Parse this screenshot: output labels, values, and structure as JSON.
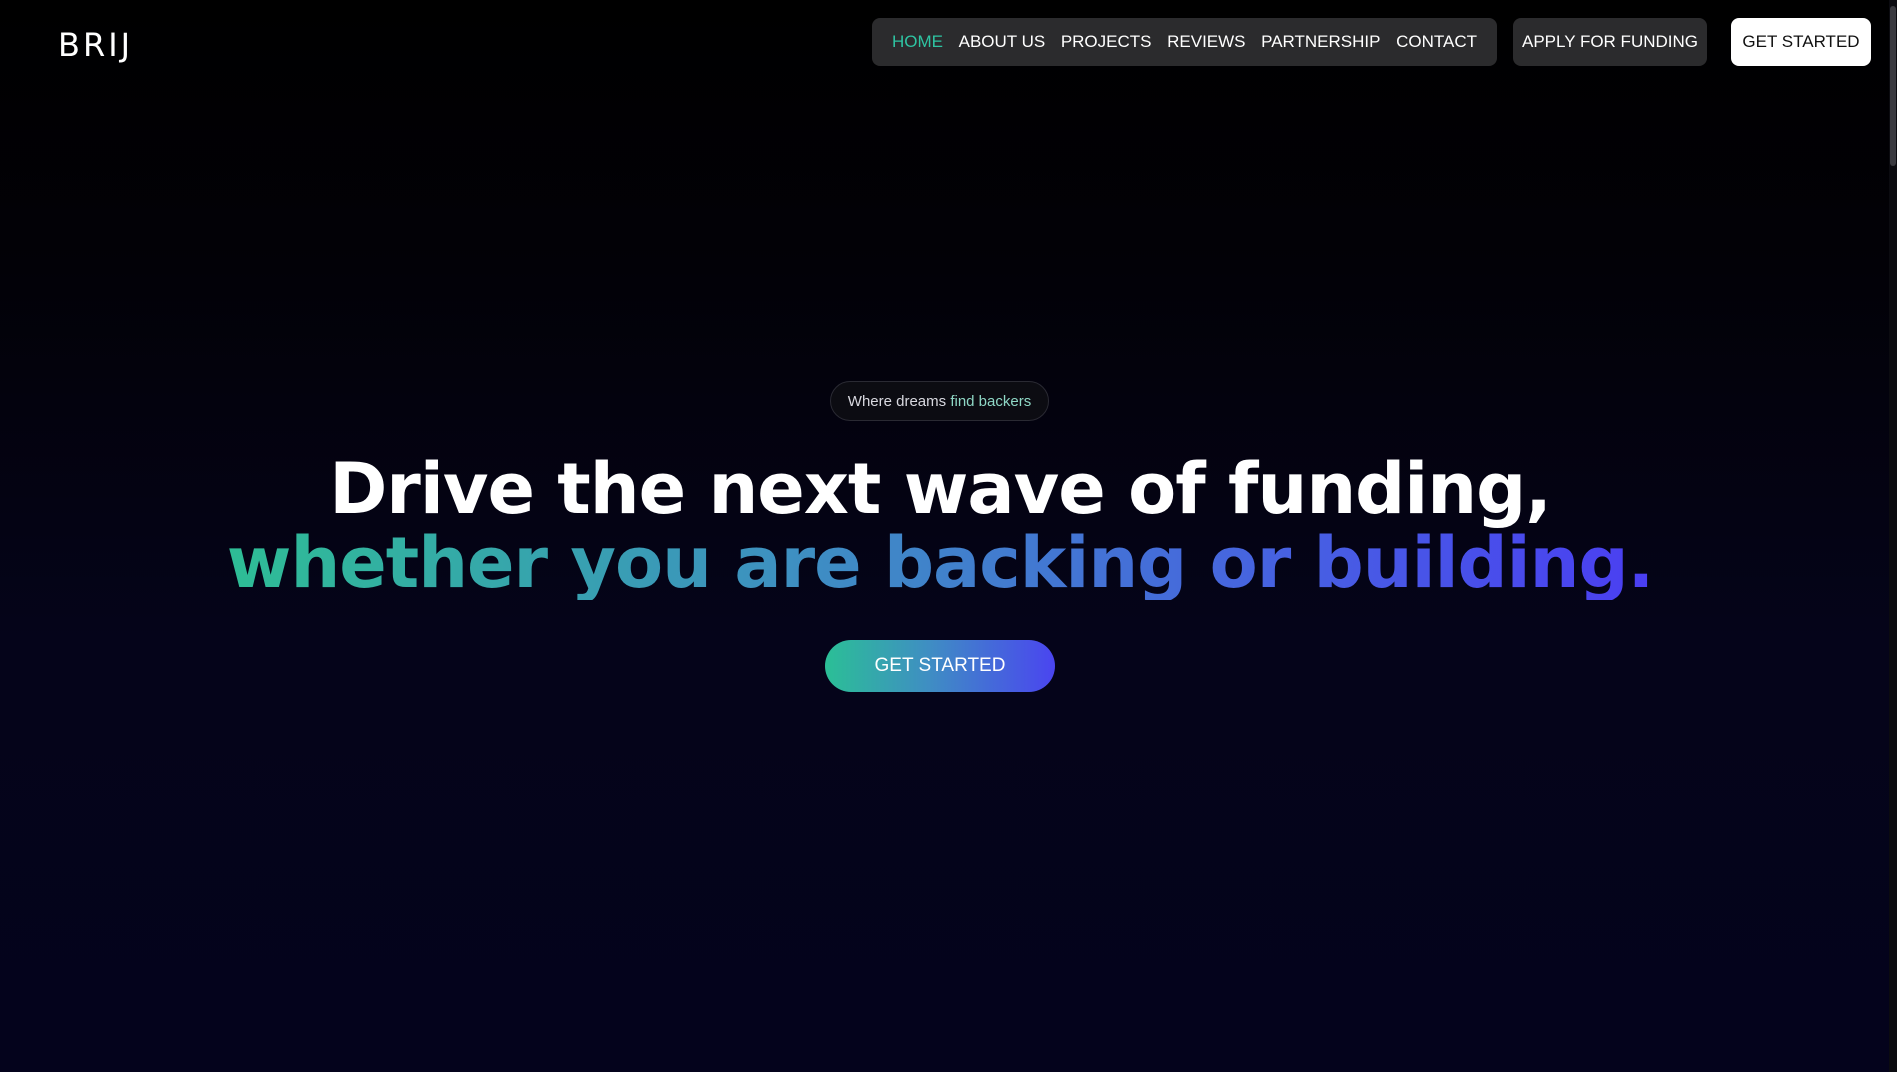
{
  "header": {
    "logo": "BRIJ",
    "nav": [
      {
        "label": "HOME",
        "active": true
      },
      {
        "label": "ABOUT US",
        "active": false
      },
      {
        "label": "PROJECTS",
        "active": false
      },
      {
        "label": "REVIEWS",
        "active": false
      },
      {
        "label": "PARTNERSHIP",
        "active": false
      },
      {
        "label": "CONTACT",
        "active": false
      }
    ],
    "apply_label": "APPLY FOR FUNDING",
    "get_started_label": "GET STARTED"
  },
  "hero": {
    "tagline_prefix": "Where dreams ",
    "tagline_highlight": "find backers",
    "headline_line1": "Drive the next wave of funding,",
    "headline_line2": "whether you are backing or building.",
    "cta_label": "GET STARTED"
  },
  "colors": {
    "active_nav": "#2ec4a2",
    "gradient_start": "#2ebd95",
    "gradient_end": "#4a3ef2",
    "nav_bg": "#2b2b2d"
  }
}
